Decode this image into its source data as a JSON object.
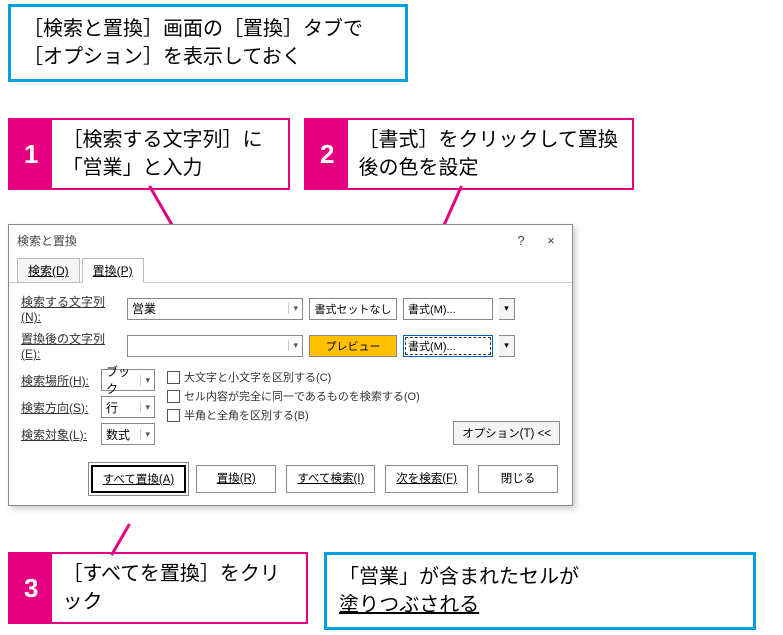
{
  "callout_top": "［検索と置換］画面の［置換］タブで［オプション］を表示しておく",
  "steps": {
    "s1": {
      "num": "1",
      "text": "［検索する文字列］に「営業」と入力"
    },
    "s2": {
      "num": "2",
      "text": "［書式］をクリックして置換後の色を設定"
    },
    "s3": {
      "num": "3",
      "text": "［すべてを置換］をクリック"
    }
  },
  "callout_bottom_a": "「営業」が含まれたセルが",
  "callout_bottom_b": "塗りつぶされる",
  "dialog": {
    "title": "検索と置換",
    "help": "?",
    "close": "×",
    "tabs": {
      "find": "検索(D)",
      "replace": "置換(P)"
    },
    "find_label": "検索する文字列(N):",
    "find_value": "営業",
    "replace_label": "置換後の文字列(E):",
    "replace_value": "",
    "format_none": "書式セットなし",
    "format_preview": "プレビュー",
    "format_btn": "書式(M)...",
    "within_label": "検索場所(H):",
    "within_value": "ブック",
    "direction_label": "検索方向(S):",
    "direction_value": "行",
    "lookin_label": "検索対象(L):",
    "lookin_value": "数式",
    "chk_case": "大文字と小文字を区別する(C)",
    "chk_whole": "セル内容が完全に同一であるものを検索する(O)",
    "chk_width": "半角と全角を区別する(B)",
    "options_btn": "オプション(T) <<",
    "btn_replace_all": "すべて置換(A)",
    "btn_replace": "置換(R)",
    "btn_find_all": "すべて検索(I)",
    "btn_find_next": "次を検索(F)",
    "btn_close": "閉じる"
  }
}
